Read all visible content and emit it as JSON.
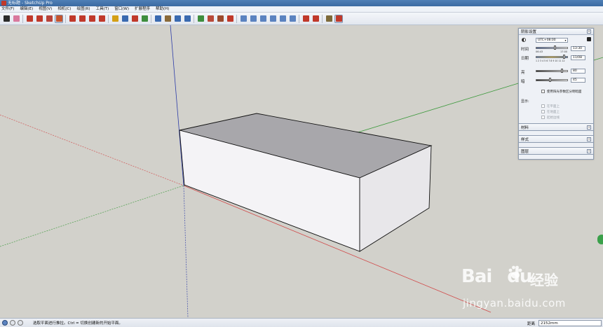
{
  "window": {
    "title": "无标题 - SketchUp Pro"
  },
  "menu": [
    "文件(F)",
    "编辑(E)",
    "视图(V)",
    "相机(C)",
    "绘图(R)",
    "工具(T)",
    "窗口(W)",
    "扩展程序",
    "帮助(H)"
  ],
  "toolbar": {
    "tools": [
      {
        "name": "select-tool",
        "color": "#2b2b2b"
      },
      {
        "name": "eraser-tool",
        "color": "#d9799e"
      },
      {
        "name": "line-tool",
        "color": "#c0392b"
      },
      {
        "name": "arc-tool",
        "color": "#c0392b"
      },
      {
        "name": "shape-tool",
        "color": "#b9433a"
      },
      {
        "name": "push-pull-tool",
        "color": "#c6532e"
      },
      {
        "name": "offset-tool",
        "color": "#c0392b"
      },
      {
        "name": "move-tool",
        "color": "#c0392b"
      },
      {
        "name": "rotate-tool",
        "color": "#c0392b"
      },
      {
        "name": "scale-tool",
        "color": "#c0392b"
      },
      {
        "name": "tape-measure-tool",
        "color": "#d4a017"
      },
      {
        "name": "text-tool",
        "color": "#3a6ab0"
      },
      {
        "name": "axes-tool",
        "color": "#c0392b"
      },
      {
        "name": "paint-bucket-tool",
        "color": "#3e8e3e"
      },
      {
        "name": "orbit-tool",
        "color": "#3a6ab0"
      },
      {
        "name": "pan-tool",
        "color": "#8a6a3a"
      },
      {
        "name": "zoom-tool",
        "color": "#3a6ab0"
      },
      {
        "name": "zoom-extents-tool",
        "color": "#3a6ab0"
      },
      {
        "name": "warehouse-tool",
        "color": "#3e8e3e"
      },
      {
        "name": "extension-warehouse-tool",
        "color": "#b94a3a"
      },
      {
        "name": "components-tool",
        "color": "#9c4a2e"
      },
      {
        "name": "styles-tool",
        "color": "#c0392b"
      },
      {
        "name": "iso-view",
        "color": "#5b83c0"
      },
      {
        "name": "top-view",
        "color": "#5b83c0"
      },
      {
        "name": "front-view",
        "color": "#5b83c0"
      },
      {
        "name": "right-view",
        "color": "#5b83c0"
      },
      {
        "name": "back-view",
        "color": "#5b83c0"
      },
      {
        "name": "left-view",
        "color": "#5b83c0"
      },
      {
        "name": "section-plane-tool",
        "color": "#c0392b"
      },
      {
        "name": "follow-me-tool",
        "color": "#c0392b"
      },
      {
        "name": "sandbox-tool",
        "color": "#7d6a3a"
      },
      {
        "name": "shadows-toggle",
        "color": "#c0392b"
      }
    ]
  },
  "shadow_panel": {
    "title": "阴影设置",
    "timezone": "UTC+08:00",
    "time_label": "时间",
    "time_start_tick": "06:43",
    "time_end_tick": "17:00",
    "time_value": "13:30",
    "date_label": "日期",
    "date_ticks": "1 2 3 4 5 6 7 8 9 10 11 12",
    "date_value": "11/08",
    "light_label": "亮",
    "light_value": "80",
    "light_level": 0.82,
    "dark_label": "暗",
    "dark_value": "45",
    "dark_level": 0.45,
    "sun_shading_label": "使用阳光参数区分明暗面",
    "display_label": "显示:",
    "on_faces": "在平面上",
    "on_ground": "在地面上",
    "from_edges": "起始边线"
  },
  "trays": [
    {
      "title": "材料"
    },
    {
      "title": "样式"
    },
    {
      "title": "图层"
    }
  ],
  "watermark": {
    "brand": "Bai",
    "brand2": "du",
    "cn": "经验",
    "url": "jingyan.baidu.com"
  },
  "status": {
    "hint": "选取平面进行推拉。Ctrl = 切换创建新的开始平面。",
    "measure_label": "距离",
    "measure_value": "2152mm"
  },
  "colors": {
    "viewport_bg": "#d2d1cb",
    "box_top": "#a8a7ab",
    "box_front": "#f4f3f6",
    "box_side": "#e8e7ea",
    "axis_red": "#d14b4b",
    "axis_green": "#3e9a3e",
    "axis_blue": "#2d3ca8"
  }
}
